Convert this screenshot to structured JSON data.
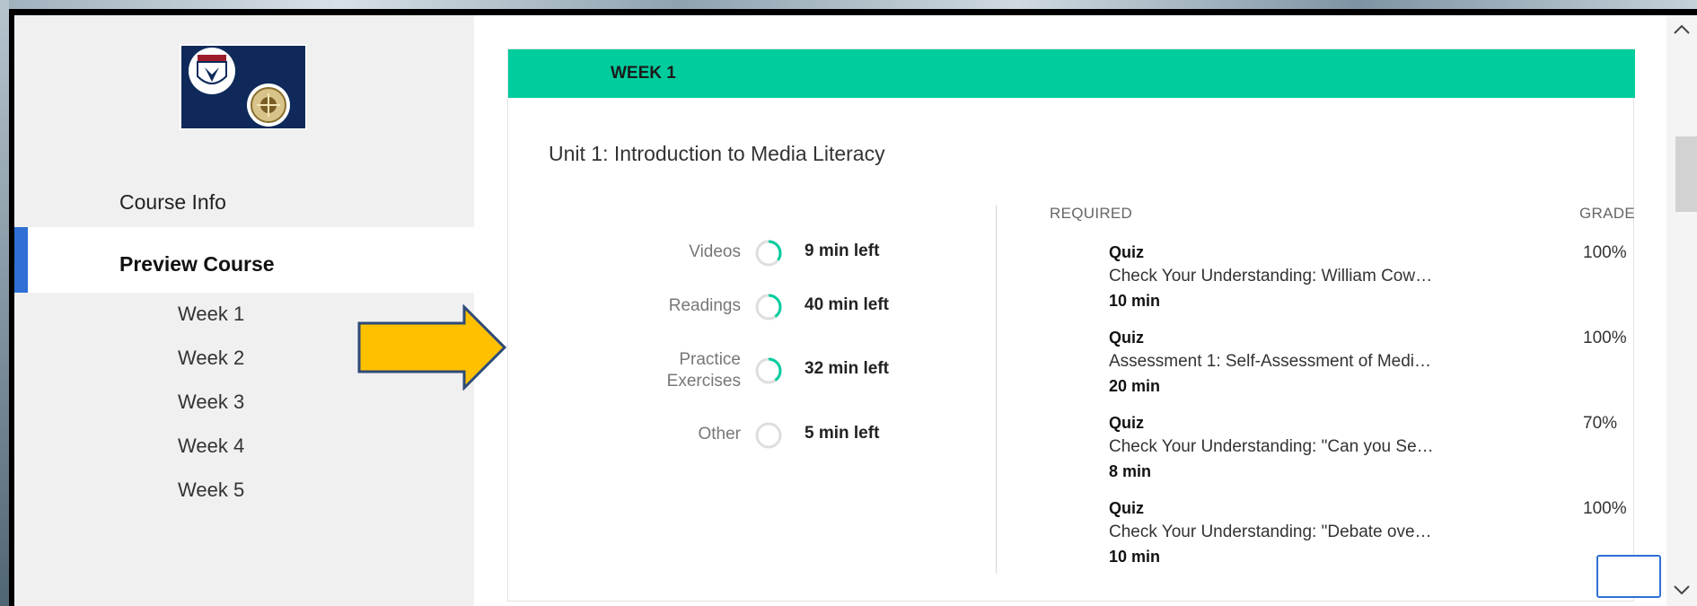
{
  "sidebar": {
    "logo_alt": "University seals",
    "course_info_label": "Course Info",
    "preview_course_label": "Preview Course",
    "weeks": [
      "Week 1",
      "Week 2",
      "Week 3",
      "Week 4",
      "Week 5"
    ]
  },
  "week": {
    "title": "WEEK 1",
    "unit_title": "Unit 1: Introduction to Media Literacy"
  },
  "stats": [
    {
      "label": "Videos",
      "value": "9 min left",
      "progress": 0.35
    },
    {
      "label": "Readings",
      "value": "40 min left",
      "progress": 0.4
    },
    {
      "label": "Practice\nExercises",
      "value": "32 min left",
      "progress": 0.4
    },
    {
      "label": "Other",
      "value": "5 min left",
      "progress": 0
    }
  ],
  "columns": {
    "required": "REQUIRED",
    "grade": "GRADE"
  },
  "required_items": [
    {
      "type": "Quiz",
      "name": "Check Your Understanding: William Cow…",
      "duration": "10 min",
      "grade": "100%"
    },
    {
      "type": "Quiz",
      "name": "Assessment 1: Self-Assessment of Medi…",
      "duration": "20 min",
      "grade": "100%"
    },
    {
      "type": "Quiz",
      "name": "Check Your Understanding: \"Can you Se…",
      "duration": "8 min",
      "grade": "70%"
    },
    {
      "type": "Quiz",
      "name": "Check Your Understanding: \"Debate ove…",
      "duration": "10 min",
      "grade": "100%"
    }
  ],
  "colors": {
    "accent": "#00cc9d",
    "nav_accent": "#2f6fd6",
    "arrow_fill": "#ffc000",
    "arrow_stroke": "#2e4a78"
  }
}
